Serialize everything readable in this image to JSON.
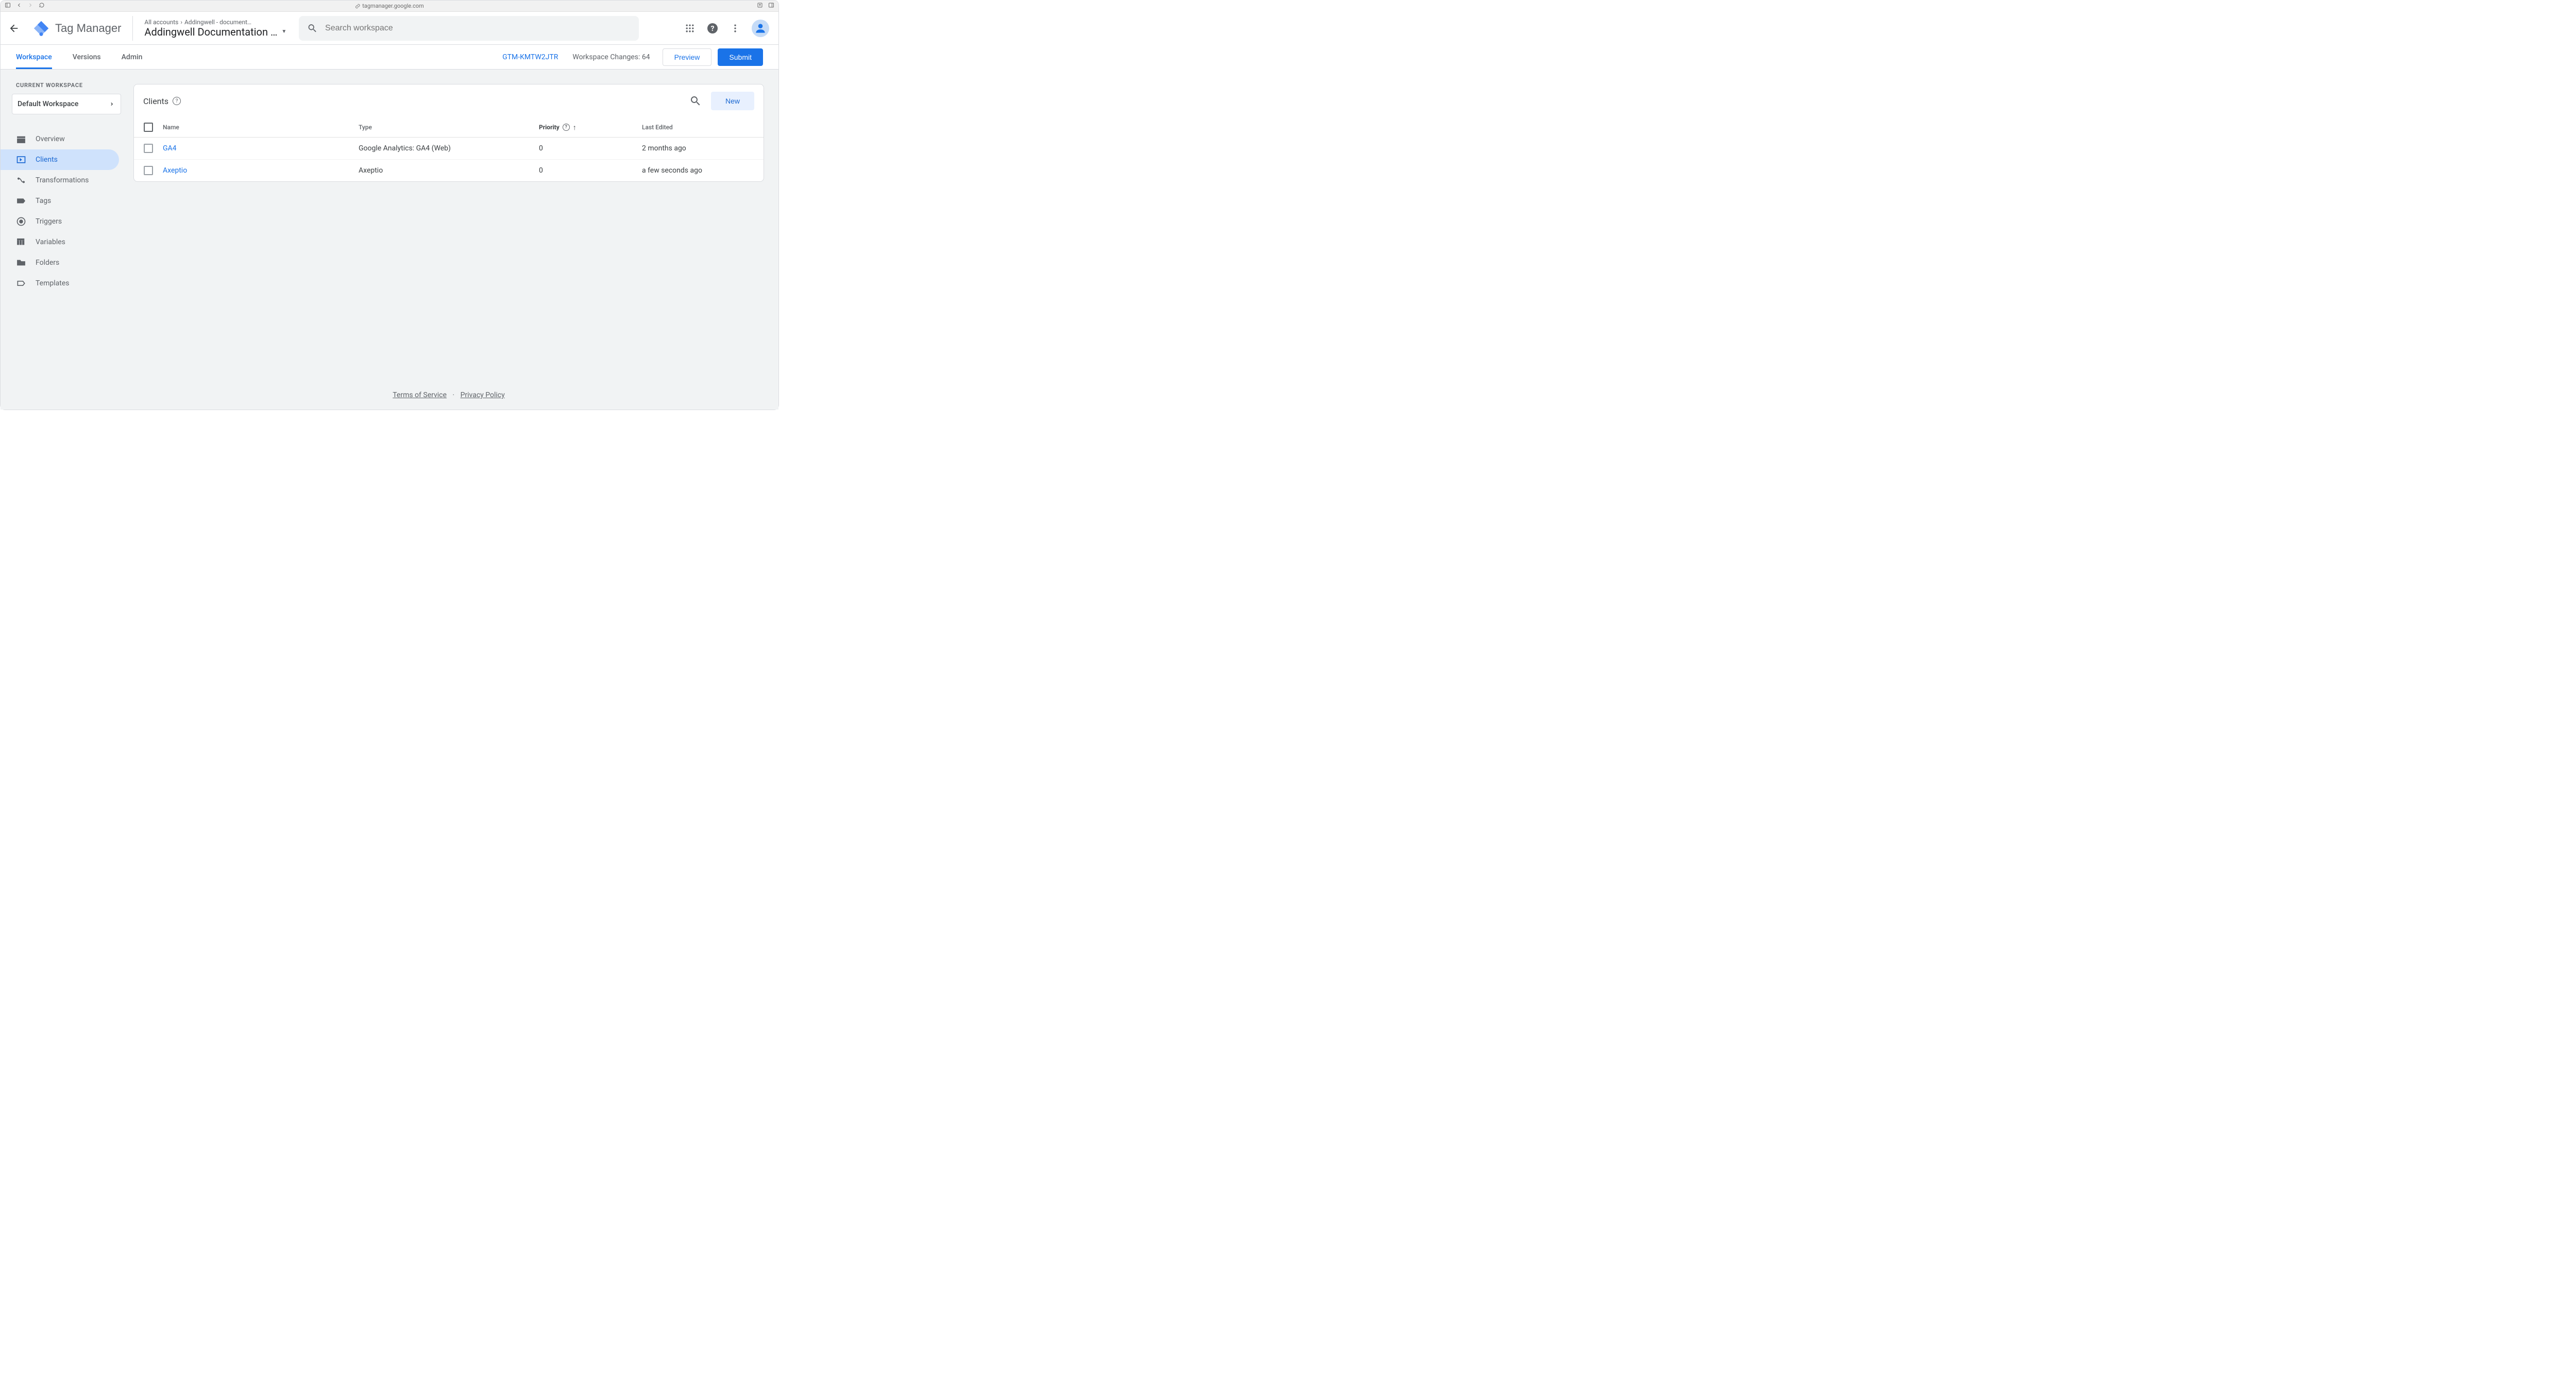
{
  "chrome": {
    "url": "tagmanager.google.com"
  },
  "header": {
    "product_name": "Tag Manager",
    "breadcrumb_root": "All accounts",
    "breadcrumb_account": "Addingwell - document…",
    "container_name": "Addingwell Documentation …",
    "search_placeholder": "Search workspace"
  },
  "tabs": {
    "workspace": "Workspace",
    "versions": "Versions",
    "admin": "Admin",
    "container_id": "GTM-KMTW2JTR",
    "workspace_changes_label": "Workspace Changes: ",
    "workspace_changes_count": "64",
    "preview": "Preview",
    "submit": "Submit"
  },
  "sidebar": {
    "current_workspace_label": "CURRENT WORKSPACE",
    "workspace_name": "Default Workspace",
    "items": {
      "overview": "Overview",
      "clients": "Clients",
      "transformations": "Transformations",
      "tags": "Tags",
      "triggers": "Triggers",
      "variables": "Variables",
      "folders": "Folders",
      "templates": "Templates"
    }
  },
  "card": {
    "title": "Clients",
    "new_button": "New",
    "columns": {
      "name": "Name",
      "type": "Type",
      "priority": "Priority",
      "last_edited": "Last Edited"
    },
    "rows": [
      {
        "name": "GA4",
        "type": "Google Analytics: GA4 (Web)",
        "priority": "0",
        "last_edited": "2 months ago"
      },
      {
        "name": "Axeptio",
        "type": "Axeptio",
        "priority": "0",
        "last_edited": "a few seconds ago"
      }
    ]
  },
  "footer": {
    "tos": "Terms of Service",
    "privacy": "Privacy Policy"
  }
}
